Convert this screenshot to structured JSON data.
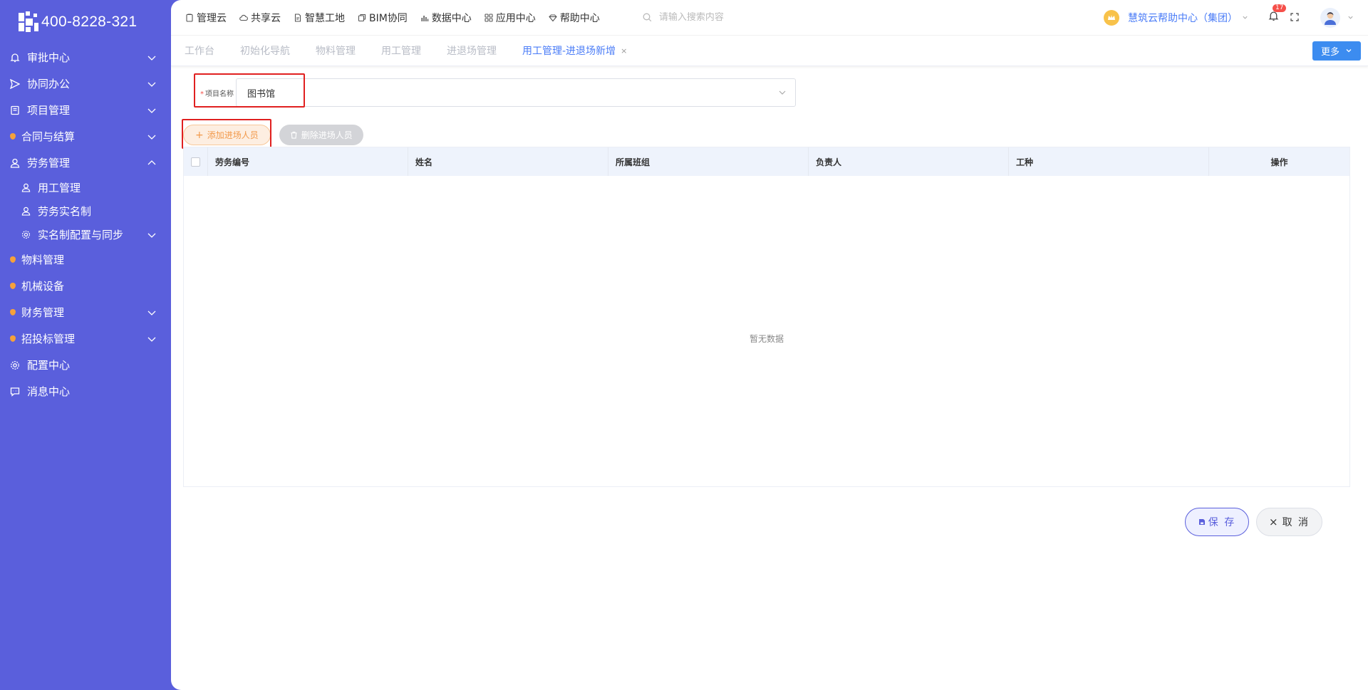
{
  "brand": {
    "phone": "400-8228-321"
  },
  "sidebar": {
    "items": [
      {
        "label": "审批中心",
        "icon": "bell-icon"
      },
      {
        "label": "协同办公",
        "icon": "send-icon"
      },
      {
        "label": "项目管理",
        "icon": "book-icon"
      },
      {
        "label": "合同与结算",
        "icon": "orange-dot"
      },
      {
        "label": "劳务管理",
        "icon": "user-icon"
      },
      {
        "label": "用工管理",
        "icon": "user-icon"
      },
      {
        "label": "劳务实名制",
        "icon": "users-icon"
      },
      {
        "label": "实名制配置与同步",
        "icon": "gear-icon"
      },
      {
        "label": "物料管理",
        "icon": "orange-dot"
      },
      {
        "label": "机械设备",
        "icon": "orange-dot"
      },
      {
        "label": "财务管理",
        "icon": "orange-dot"
      },
      {
        "label": "招投标管理",
        "icon": "orange-dot"
      },
      {
        "label": "配置中心",
        "icon": "gear-icon"
      },
      {
        "label": "消息中心",
        "icon": "chat-icon"
      }
    ]
  },
  "topnav": {
    "items": [
      {
        "label": "管理云",
        "icon": "clipboard-icon"
      },
      {
        "label": "共享云",
        "icon": "cloud-icon"
      },
      {
        "label": "智慧工地",
        "icon": "document-icon"
      },
      {
        "label": "BIM协同",
        "icon": "cube-icon"
      },
      {
        "label": "数据中心",
        "icon": "bar-chart-icon"
      },
      {
        "label": "应用中心",
        "icon": "grid-icon"
      },
      {
        "label": "帮助中心",
        "icon": "diamond-icon"
      }
    ],
    "search_placeholder": "请输入搜索内容",
    "help_center": "慧筑云帮助中心（集团）",
    "notification_count": "17"
  },
  "tabs": {
    "items": [
      "工作台",
      "初始化导航",
      "物料管理",
      "用工管理",
      "进退场管理",
      "用工管理-进退场新增"
    ],
    "close": "×",
    "more": "更多"
  },
  "form": {
    "required_mark": "*",
    "project_label": "项目名称",
    "project_value": "图书馆"
  },
  "toolbar": {
    "add_label": "添加进场人员",
    "delete_label": "删除进场人员"
  },
  "table": {
    "columns": [
      "劳务编号",
      "姓名",
      "所属班组",
      "负责人",
      "工种",
      "操作"
    ],
    "empty_text": "暂无数据"
  },
  "actions": {
    "save_label": "保 存",
    "cancel_label": "取 消"
  },
  "colors": {
    "sidebar_bg": "#5a5fdc",
    "accent_blue": "#4a7cf7",
    "highlight_red": "#e02020",
    "add_orange": "#f2994a"
  }
}
